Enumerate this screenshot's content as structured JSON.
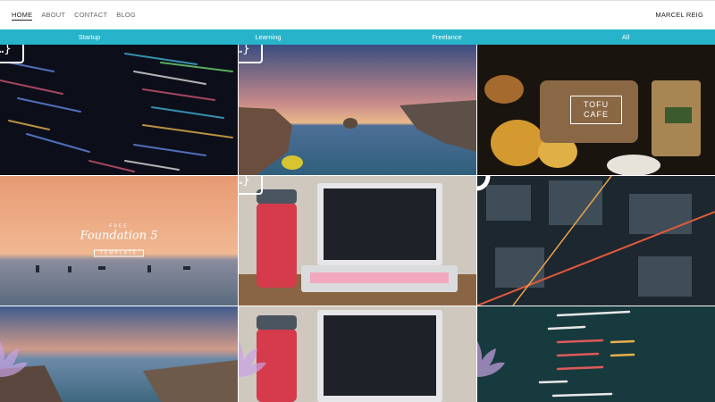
{
  "nav": {
    "items": [
      {
        "label": "HOME",
        "active": true
      },
      {
        "label": "ABOUT",
        "active": false
      },
      {
        "label": "CONTACT",
        "active": false
      },
      {
        "label": "BLOG",
        "active": false
      }
    ],
    "brand": "MARCEL REIG"
  },
  "filters": [
    "Startup",
    "Learning",
    "Freelance",
    "All"
  ],
  "colors": {
    "accent": "#27b4cb"
  },
  "tiles": [
    {
      "overlay_icon": "code-window-icon"
    },
    {
      "overlay_icon": "code-window-icon"
    },
    {
      "overlay_icon": "tofu-cafe-logo",
      "logo_text": [
        "TOFU",
        "CAFE"
      ]
    },
    {
      "overlay_icon": "foundation-logo",
      "logo_text": [
        "FREE",
        "Foundation 5",
        "TEMPLATE"
      ]
    },
    {
      "overlay_icon": "code-window-icon"
    },
    {
      "overlay_icon": "ring-logo-icon"
    },
    {
      "overlay_icon": "lotus-icon"
    },
    {
      "overlay_icon": "lotus-icon"
    },
    {
      "overlay_icon": "lotus-icon"
    }
  ]
}
